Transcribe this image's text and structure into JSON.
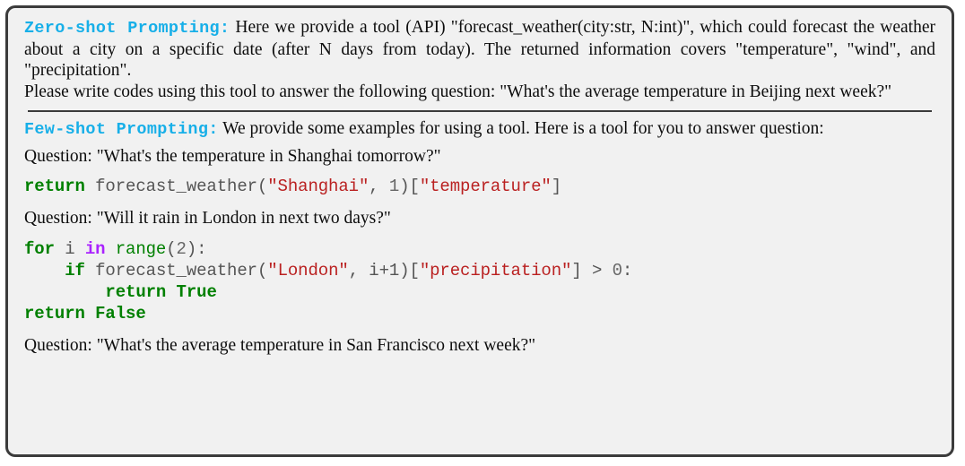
{
  "figure": {
    "background_color": "#f1f1f1",
    "border_color": "#3b3b3b",
    "accent_label_color": "#17afe8",
    "string_color": "#ba2121",
    "keyword_color": "#008000",
    "operator_keyword_color": "#aa22ff",
    "number_color": "#666666"
  },
  "zero_shot": {
    "label": "Zero-shot Prompting:",
    "body": "Here we provide a tool (API) \"forecast_weather(city:str, N:int)\", which could forecast the weather about a city on a specific date (after N days from today).  The returned information covers \"temperature\", \"wind\", and \"precipitation\".",
    "instruction": "Please write codes using this tool to answer the following question: \"What's the average temperature in Beijing next week?\""
  },
  "few_shot": {
    "label": "Few-shot Prompting:",
    "body": "We provide some examples for using a tool. Here is a tool for you to answer question:",
    "example1": {
      "question": "Question: \"What's the temperature in Shanghai tomorrow?\"",
      "code": {
        "kw_return": "return",
        "fn": " forecast_weather(",
        "str_city": "\"Shanghai\"",
        "comma": ", ",
        "num_n": "1",
        "bracket_open": ")[",
        "str_field": "\"temperature\"",
        "bracket_close": "]"
      }
    },
    "example2": {
      "question": "Question: \"Will it rain in London in next two days?\"",
      "code": {
        "kw_for": "for",
        "var_i": " i ",
        "kw_in": "in",
        "bi_range": " range",
        "paren_open": "(",
        "num_2": "2",
        "paren_colon": "):",
        "indent1": "    ",
        "kw_if": "if",
        "fn": " forecast_weather(",
        "str_city": "\"London\"",
        "comma": ", ",
        "expr_i1": "i+1",
        "bracket_open": ")[",
        "str_field": "\"precipitation\"",
        "bracket_close": "]",
        "cmp": " > ",
        "num_0": "0",
        "colon": ":",
        "indent2": "        ",
        "kw_return_true": "return",
        "bool_true": " True",
        "kw_return_false": "return",
        "bool_false": " False"
      }
    },
    "final_question": "Question: \"What's the average temperature in San Francisco next week?\""
  }
}
